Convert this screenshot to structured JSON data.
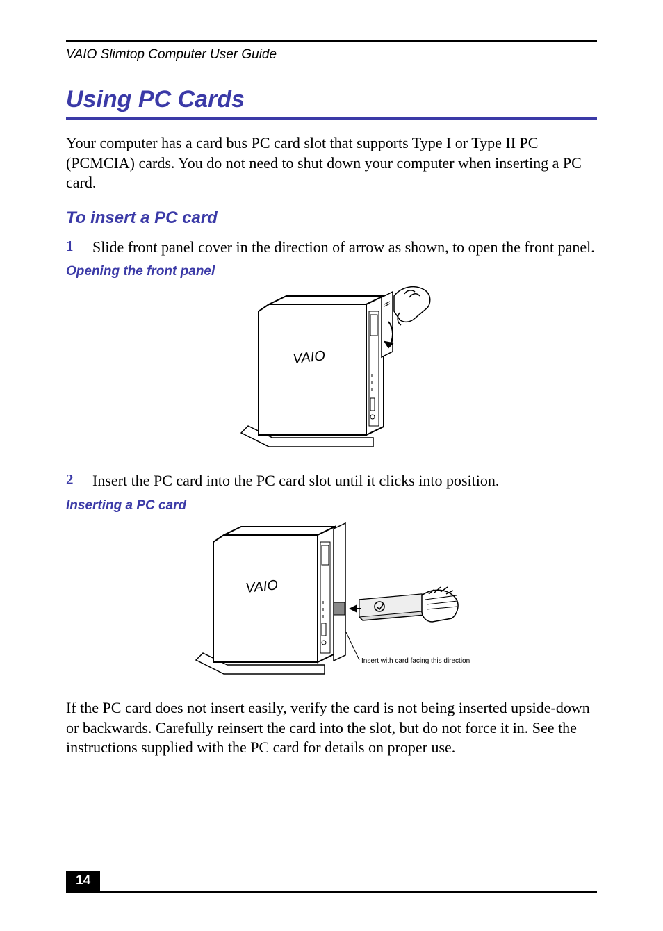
{
  "running_head": "VAIO Slimtop Computer User Guide",
  "title": "Using PC Cards",
  "intro": "Your computer has a card bus PC card slot that supports Type I or Type II PC (PCMCIA) cards. You do not need to shut down your computer when inserting a PC card.",
  "sub1": "To insert a PC card",
  "steps": {
    "1": {
      "num": "1",
      "text": "Slide front panel cover in the direction of arrow as shown, to open the front panel."
    },
    "2": {
      "num": "2",
      "text": "Insert the PC card into the PC card slot until it clicks into position."
    }
  },
  "caption1": "Opening the front panel",
  "caption2": "Inserting a PC card",
  "fig2_label": "Insert with card facing this direction",
  "note": "If the PC card does not insert easily, verify the card is not being inserted upside-down or backwards. Carefully reinsert the card into the slot, but do not force it in. See the instructions supplied with the PC card for details on proper use.",
  "page_num": "14",
  "logo": "VAIO"
}
